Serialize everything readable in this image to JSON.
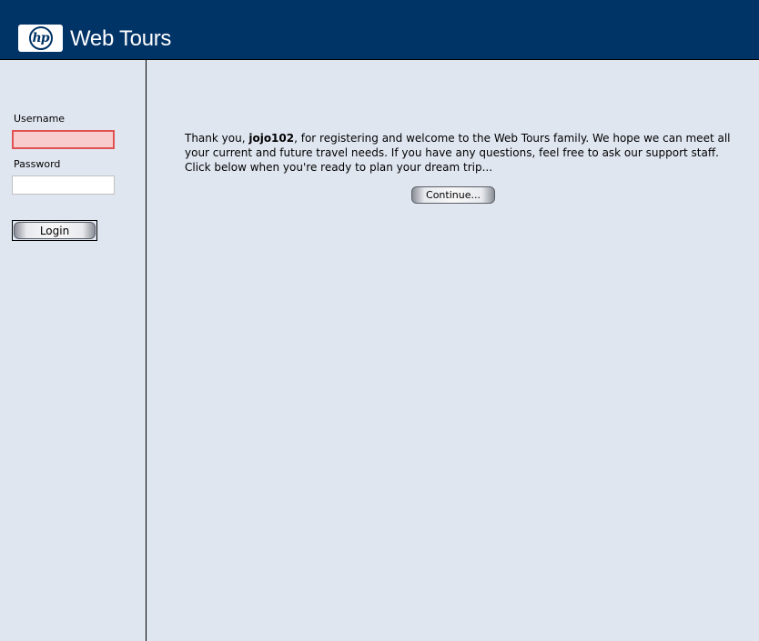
{
  "header": {
    "logo_text": "hp",
    "app_title": "Web Tours",
    "background": "#003366"
  },
  "sidebar": {
    "username_label": "Username",
    "username_value": "",
    "password_label": "Password",
    "password_value": "",
    "login_label": "Login"
  },
  "main": {
    "welcome_prefix": "Thank you, ",
    "username": "jojo102",
    "welcome_suffix": ", for registering and welcome to the Web Tours family. We hope we can meet all your current and future travel needs. If you have any questions, feel free to ask our support staff. Click below when you're ready to plan your dream trip...",
    "continue_label": "Continue..."
  },
  "colors": {
    "page_background": "#e0e6f0",
    "invalid_field_border": "#e05252",
    "invalid_field_fill": "#f8cccc"
  }
}
